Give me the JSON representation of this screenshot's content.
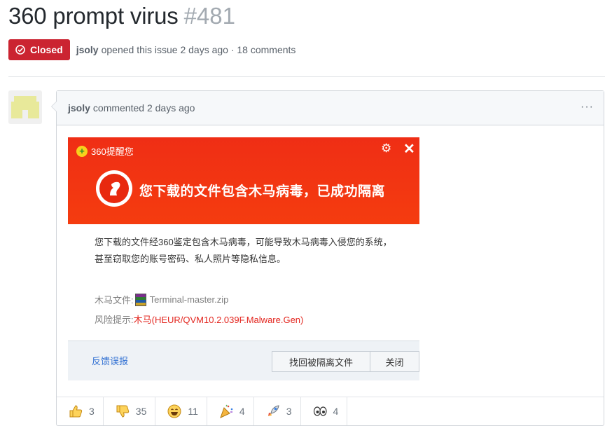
{
  "issue": {
    "title": "360 prompt virus",
    "number": "#481",
    "state_label": "Closed",
    "author": "jsoly",
    "meta_text": "opened this issue 2 days ago · 18 comments"
  },
  "comment": {
    "author": "jsoly",
    "action_text": "commented 2 days ago",
    "menu": "···",
    "screenshot": {
      "app_name": "360提醒您",
      "headline": "您下载的文件包含木马病毒，已成功隔离",
      "body_line1": "您下载的文件经360鉴定包含木马病毒，可能导致木马病毒入侵您的系统，",
      "body_line2": "甚至窃取您的账号密码、私人照片等隐私信息。",
      "file_label": "木马文件:",
      "file_name": "Terminal-master.zip",
      "risk_label": "风险提示:",
      "risk_value": "木马(HEUR/QVM10.2.039F.Malware.Gen)",
      "feedback_link": "反馈误报",
      "restore_button": "找回被隔离文件",
      "close_button": "关闭"
    },
    "reactions": [
      {
        "icon": "thumbs-up-icon",
        "count": "3"
      },
      {
        "icon": "thumbs-down-icon",
        "count": "35"
      },
      {
        "icon": "laugh-icon",
        "count": "11"
      },
      {
        "icon": "hooray-icon",
        "count": "4"
      },
      {
        "icon": "rocket-icon",
        "count": "3"
      },
      {
        "icon": "eyes-icon",
        "count": "4"
      }
    ]
  },
  "colors": {
    "closed_badge": "#cb2431",
    "alert_red": "#ef2e15",
    "risk_text": "#e3261f",
    "link_blue": "#2f6fd2"
  }
}
